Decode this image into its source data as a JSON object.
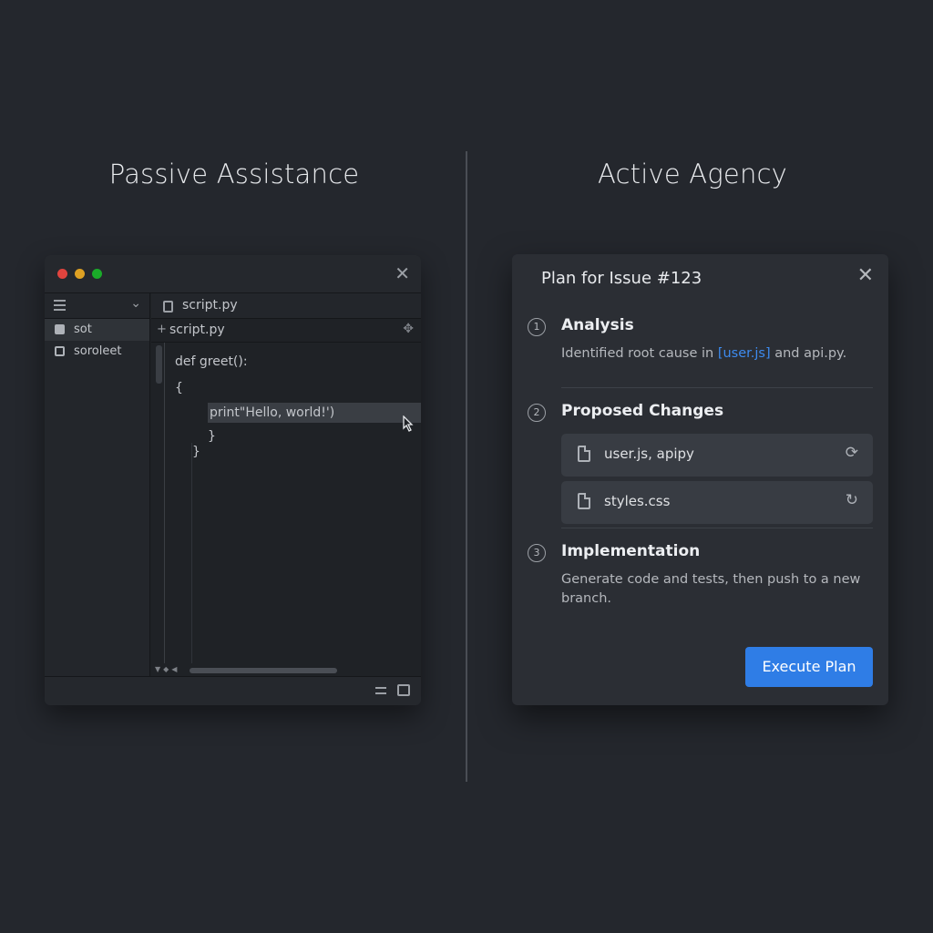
{
  "headings": {
    "left": "Passive Assistance",
    "right": "Active Agency"
  },
  "editor": {
    "window_controls": [
      "close-dot",
      "minimize-dot",
      "maximize-dot"
    ],
    "sidebar": {
      "items": [
        {
          "label": "sot",
          "icon": "file-icon"
        },
        {
          "label": "soroleet",
          "icon": "grid-icon"
        }
      ]
    },
    "tab_label": "script.py",
    "file_label": "script.py",
    "code_lines": [
      "def greet():",
      "{",
      "print\"Hello, world!')",
      "}",
      "}"
    ]
  },
  "plan": {
    "title": "Plan for Issue #123",
    "steps": [
      {
        "number": "1",
        "title": "Analysis",
        "desc_prefix": "Identified root cause in ",
        "desc_link": "[user.js]",
        "desc_suffix": " and api.py."
      },
      {
        "number": "2",
        "title": "Proposed Changes",
        "files": [
          {
            "label": "user.js, apipy",
            "action_icon": "sync-icon"
          },
          {
            "label": "styles.css",
            "action_icon": "refresh-icon"
          }
        ]
      },
      {
        "number": "3",
        "title": "Implementation",
        "desc": "Generate code and tests, then push to a new branch."
      }
    ],
    "execute_label": "Execute Plan"
  },
  "colors": {
    "background": "#24272d",
    "accent": "#2f7de6",
    "link": "#3d8bf0"
  }
}
